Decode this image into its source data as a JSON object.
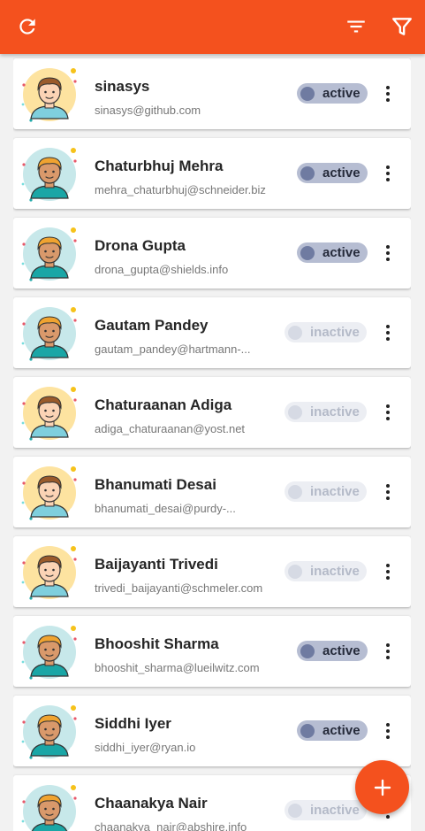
{
  "toolbar": {
    "refresh_icon": "refresh-icon",
    "sort_icon": "sort-icon",
    "filter_icon": "filter-icon",
    "accent_color": "#f4511e"
  },
  "users": [
    {
      "name": "sinasys",
      "email": "sinasys@github.com",
      "status": "active",
      "avatar": "yellow"
    },
    {
      "name": "Chaturbhuj Mehra",
      "email": "mehra_chaturbhuj@schneider.biz",
      "status": "active",
      "avatar": "teal"
    },
    {
      "name": "Drona Gupta",
      "email": "drona_gupta@shields.info",
      "status": "active",
      "avatar": "teal"
    },
    {
      "name": "Gautam Pandey",
      "email": "gautam_pandey@hartmann-...",
      "status": "inactive",
      "avatar": "teal"
    },
    {
      "name": "Chaturaanan Adiga",
      "email": "adiga_chaturaanan@yost.net",
      "status": "inactive",
      "avatar": "yellow"
    },
    {
      "name": "Bhanumati Desai",
      "email": "bhanumati_desai@purdy-...",
      "status": "inactive",
      "avatar": "yellow"
    },
    {
      "name": "Baijayanti Trivedi",
      "email": "trivedi_baijayanti@schmeler.com",
      "status": "inactive",
      "avatar": "yellow"
    },
    {
      "name": "Bhooshit Sharma",
      "email": "bhooshit_sharma@lueilwitz.com",
      "status": "active",
      "avatar": "teal"
    },
    {
      "name": "Siddhi Iyer",
      "email": "siddhi_iyer@ryan.io",
      "status": "active",
      "avatar": "teal"
    },
    {
      "name": "Chaanakya Nair",
      "email": "chaanakya_nair@abshire.info",
      "status": "inactive",
      "avatar": "teal"
    }
  ],
  "fab": {
    "icon": "plus-icon",
    "label": "+"
  }
}
